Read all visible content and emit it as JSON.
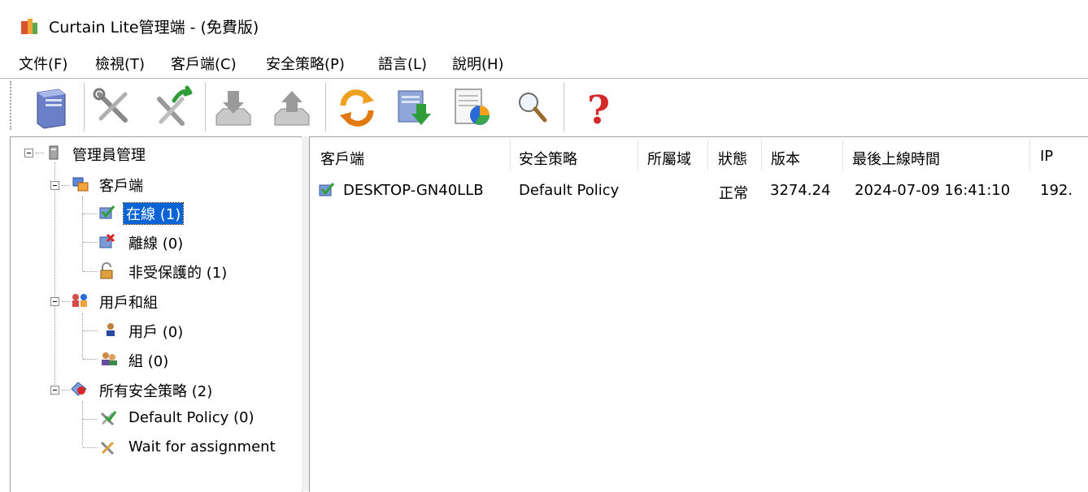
{
  "window": {
    "title": "Curtain Lite管理端 - (免費版)"
  },
  "menu": [
    {
      "label": "文件(F)"
    },
    {
      "label": "檢視(T)"
    },
    {
      "label": "客戶端(C)"
    },
    {
      "label": "安全策略(P)"
    },
    {
      "label": "語言(L)"
    },
    {
      "label": "說明(H)"
    }
  ],
  "toolbar": {
    "buttons": [
      {
        "icon": "server-icon"
      },
      {
        "icon": "tools-icon"
      },
      {
        "icon": "deploy-tools-icon"
      },
      {
        "icon": "import-icon"
      },
      {
        "icon": "export-icon"
      },
      {
        "icon": "refresh-icon"
      },
      {
        "icon": "download-icon"
      },
      {
        "icon": "report-chart-icon"
      },
      {
        "icon": "search-icon"
      },
      {
        "icon": "help-icon"
      }
    ]
  },
  "tree": {
    "root": "管理員管理",
    "clients": "客戶端",
    "online": "在線 (1)",
    "offline": "離線 (0)",
    "unprotected": "非受保護的 (1)",
    "users_groups": "用戶和組",
    "users": "用戶 (0)",
    "groups": "組 (0)",
    "all_policies": "所有安全策略 (2)",
    "default_policy": "Default Policy (0)",
    "wait_assignment": "Wait for assignment"
  },
  "table": {
    "headers": [
      "客戶端",
      "安全策略",
      "所屬域",
      "狀態",
      "版本",
      "最後上線時間",
      "IP"
    ],
    "rows": [
      [
        "DESKTOP-GN40LLB",
        "Default Policy",
        "",
        "正常",
        "3274.24",
        "2024-07-09 16:41:10",
        "192."
      ]
    ]
  },
  "colors": {
    "selection": "#0a64d6",
    "help": "#d62828"
  }
}
